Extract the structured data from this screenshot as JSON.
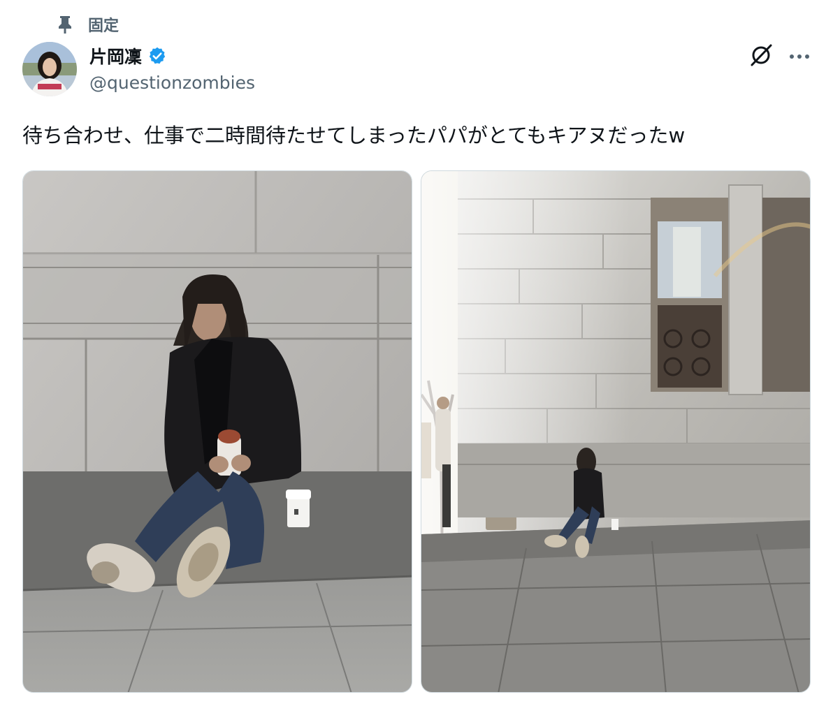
{
  "pinned": {
    "label": "固定",
    "icon": "pin-icon"
  },
  "author": {
    "display_name": "片岡凜",
    "handle": "@questionzombies",
    "verified": true,
    "avatar_icon": "avatar"
  },
  "actions": {
    "grok_icon": "grok-icon",
    "more_icon": "more-icon"
  },
  "tweet": {
    "text": "待ち合わせ、仕事で二時間待たせてしまったパパがとてもキアヌだったw"
  },
  "media": [
    {
      "name": "photo-1",
      "description_icon": "photo-man-sitting-closeup"
    },
    {
      "name": "photo-2",
      "description_icon": "photo-man-sitting-building"
    }
  ],
  "colors": {
    "text": "#0f1419",
    "secondary": "#536471",
    "verified": "#1d9bf0",
    "border": "#cfd9de"
  }
}
